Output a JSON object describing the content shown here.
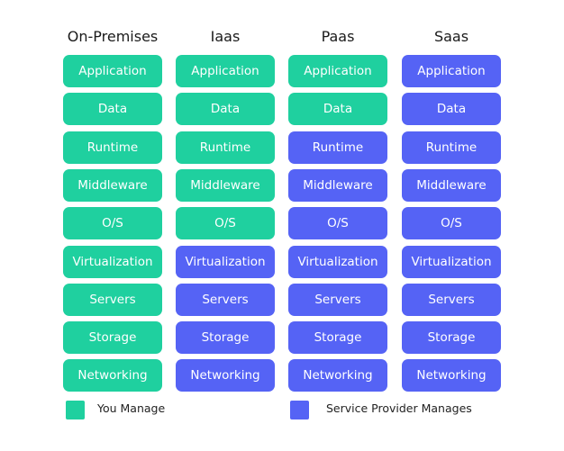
{
  "colors": {
    "you_manage": "#1fd09f",
    "provider_manages": "#5563f5"
  },
  "columns": [
    {
      "title": "On-Premises",
      "provider_from_index": 9
    },
    {
      "title": "Iaas",
      "provider_from_index": 5
    },
    {
      "title": "Paas",
      "provider_from_index": 2
    },
    {
      "title": "Saas",
      "provider_from_index": 0
    }
  ],
  "layers": [
    "Application",
    "Data",
    "Runtime",
    "Middleware",
    "O/S",
    "Virtualization",
    "Servers",
    "Storage",
    "Networking"
  ],
  "legend": {
    "you_manage_label": "You Manage",
    "provider_label": "Service Provider Manages"
  }
}
